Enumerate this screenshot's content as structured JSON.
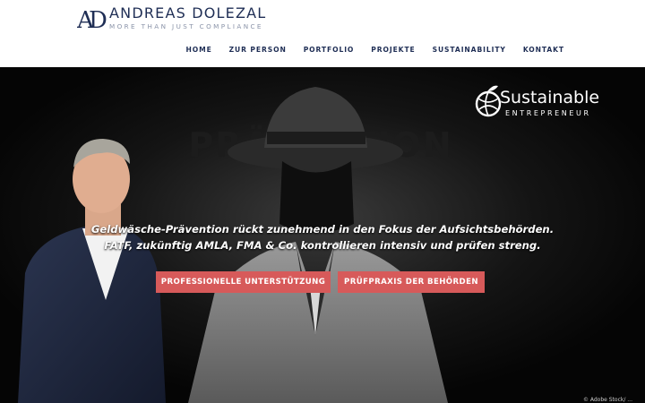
{
  "brand": {
    "name": "ANDREAS DOLEZAL",
    "tagline": "MORE THAN JUST COMPLIANCE",
    "monogram": "AD",
    "color": "#1f2e55"
  },
  "nav": {
    "items": [
      "HOME",
      "ZUR PERSON",
      "PORTFOLIO",
      "PROJEKTE",
      "SUSTAINABILITY",
      "KONTAKT"
    ]
  },
  "hero": {
    "bg_text": "PRÄVENTION",
    "badge": {
      "title": "Sustainable",
      "subtitle": "ENTREPRENEUR"
    },
    "line1": "Geldwäsche-Prävention rückt zunehmend in den Fokus der Aufsichtsbehörden.",
    "line2": "FATF, zukünftig AMLA, FMA & Co. kontrollieren intensiv und prüfen streng.",
    "button_primary": "PROFESSIONELLE UNTERSTÜTZUNG",
    "button_secondary": "PRÜFPRAXIS DER BEHÖRDEN",
    "button_color": "#d75a5a",
    "credit": "© Adobe Stock/ ..."
  }
}
